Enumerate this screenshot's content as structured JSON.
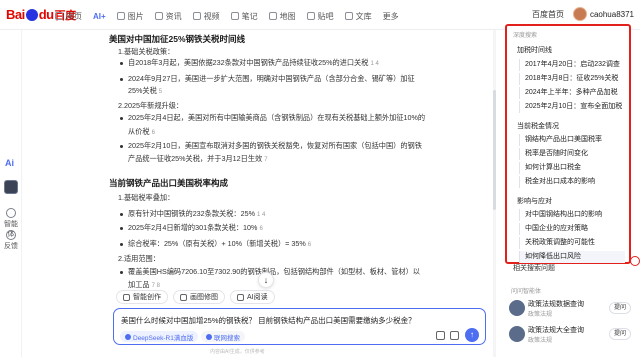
{
  "header": {
    "logo_text": "Bai",
    "logo_text2": "du",
    "logo_zh": "百度",
    "tabs": [
      {
        "label": "网页",
        "active": false,
        "icon": "web-icon"
      },
      {
        "label": "AI+",
        "active": true,
        "icon": "ai-icon"
      },
      {
        "label": "图片",
        "active": false,
        "icon": "image-icon"
      },
      {
        "label": "资讯",
        "active": false,
        "icon": "news-icon"
      },
      {
        "label": "视频",
        "active": false,
        "icon": "video-icon"
      },
      {
        "label": "笔记",
        "active": false,
        "icon": "note-icon"
      },
      {
        "label": "地图",
        "active": false,
        "icon": "map-icon"
      },
      {
        "label": "贴吧",
        "active": false,
        "icon": "tieba-icon"
      },
      {
        "label": "文库",
        "active": false,
        "icon": "wenku-icon"
      },
      {
        "label": "更多",
        "active": false,
        "icon": ""
      }
    ],
    "home_label": "百度首页",
    "username": "caohua8371"
  },
  "left_rail": {
    "ai_label": "Ai",
    "item1_label": "智能体",
    "item2_label": "反馈"
  },
  "article": {
    "title1": "美国对中国加征25%钢铁关税时间线",
    "sec1": "1.基础关税政策：",
    "sec1_b1": "自2018年3月起，美国依据232条款对中国钢铁产品持续征收25%的进口关税",
    "sec1_b1_refs": "1  4",
    "sec1_b2": "2024年9月27日，美国进一步扩大范围，明确对中国钢铁产品（含部分合金、锡矿等）加征",
    "sec1_b2_cont": "25%关税",
    "sec1_b2_refs": "5",
    "sec2": "2.2025年新规升级：",
    "sec2_b1": "2025年2月4日起，美国对所有中国输美商品（含钢铁制品）在现有关税基础上额外加征10%的",
    "sec2_b1_cont": "从价税",
    "sec2_b1_refs": "6",
    "sec2_b2": "2025年2月10日，美国宣布取消对多国的钢铁关税豁免，恢复对所有国家（包括中国）的钢铁",
    "sec2_b2_cont": "产品统一征收25%关税，并于3月12日生效",
    "sec2_b2_refs": "7",
    "title2": "当前钢铁产品出口美国税率构成",
    "sec3": "1.基础税率叠加：",
    "sec3_b1": "原有针对中国钢铁的232条款关税：25%",
    "sec3_b1_refs": "1  4",
    "sec3_b2": "2025年2月4日新增的301条款关税：10%",
    "sec3_b2_refs": "6",
    "sec3_b3": "综合税率：25%（原有关税）+ 10%（新增关税）= 35%",
    "sec3_b3_refs": "6",
    "sec4": "2.适用范围：",
    "sec4_b1": "覆盖美国HS编码7206.10至7302.90的钢铁制品，包括钢结构部件（如型材、板材、管材）以",
    "sec4_b1_cont": "加工品",
    "sec4_b1_refs": "7  8"
  },
  "tools": [
    {
      "label": "智能创作",
      "icon": "create-icon"
    },
    {
      "label": "画图修图",
      "icon": "draw-icon"
    },
    {
      "label": "AI阅读",
      "icon": "read-icon"
    }
  ],
  "input": {
    "value": "美国什么时候对中国加增25%的钢铁税？ 目前钢铁结构产品出口美国需要缴纳多少税金？",
    "model_chip": "DeepSeek-R1满血版",
    "net_chip": "联网搜索"
  },
  "footer_text": "内容由AI生成，仅供参考",
  "side_panel": {
    "header": "深度搜索",
    "sections": [
      {
        "title": "加税时间线",
        "items": [
          "2017年4月20日：启动232调查",
          "2018年3月8日：征收25%关税",
          "2024年上半年：多种产品加税",
          "2025年2月10日：宣布全面加税"
        ]
      },
      {
        "title": "当前税金情况",
        "items": [
          "钢结构产品出口美国税率",
          "税率是否随时间变化",
          "如何计算出口税金",
          "税金对出口成本的影响"
        ]
      },
      {
        "title": "影响与应对",
        "items": [
          "对中国钢结构出口的影响",
          "中国企业的应对策略",
          "关税政策调整的可能性",
          "如何降低出口风险"
        ]
      }
    ]
  },
  "related_label": "相关搜索问题",
  "agents": {
    "header": "问问智能体",
    "list": [
      {
        "title": "政策法规数据查询",
        "sub": "政策法规",
        "ask": "提问"
      },
      {
        "title": "政策法规大全查询",
        "sub": "政策法规",
        "ask": "提问"
      }
    ]
  },
  "colors": {
    "accent": "#4e6ef2",
    "highlight_border": "#e3211c",
    "brand_red": "#e10602"
  }
}
